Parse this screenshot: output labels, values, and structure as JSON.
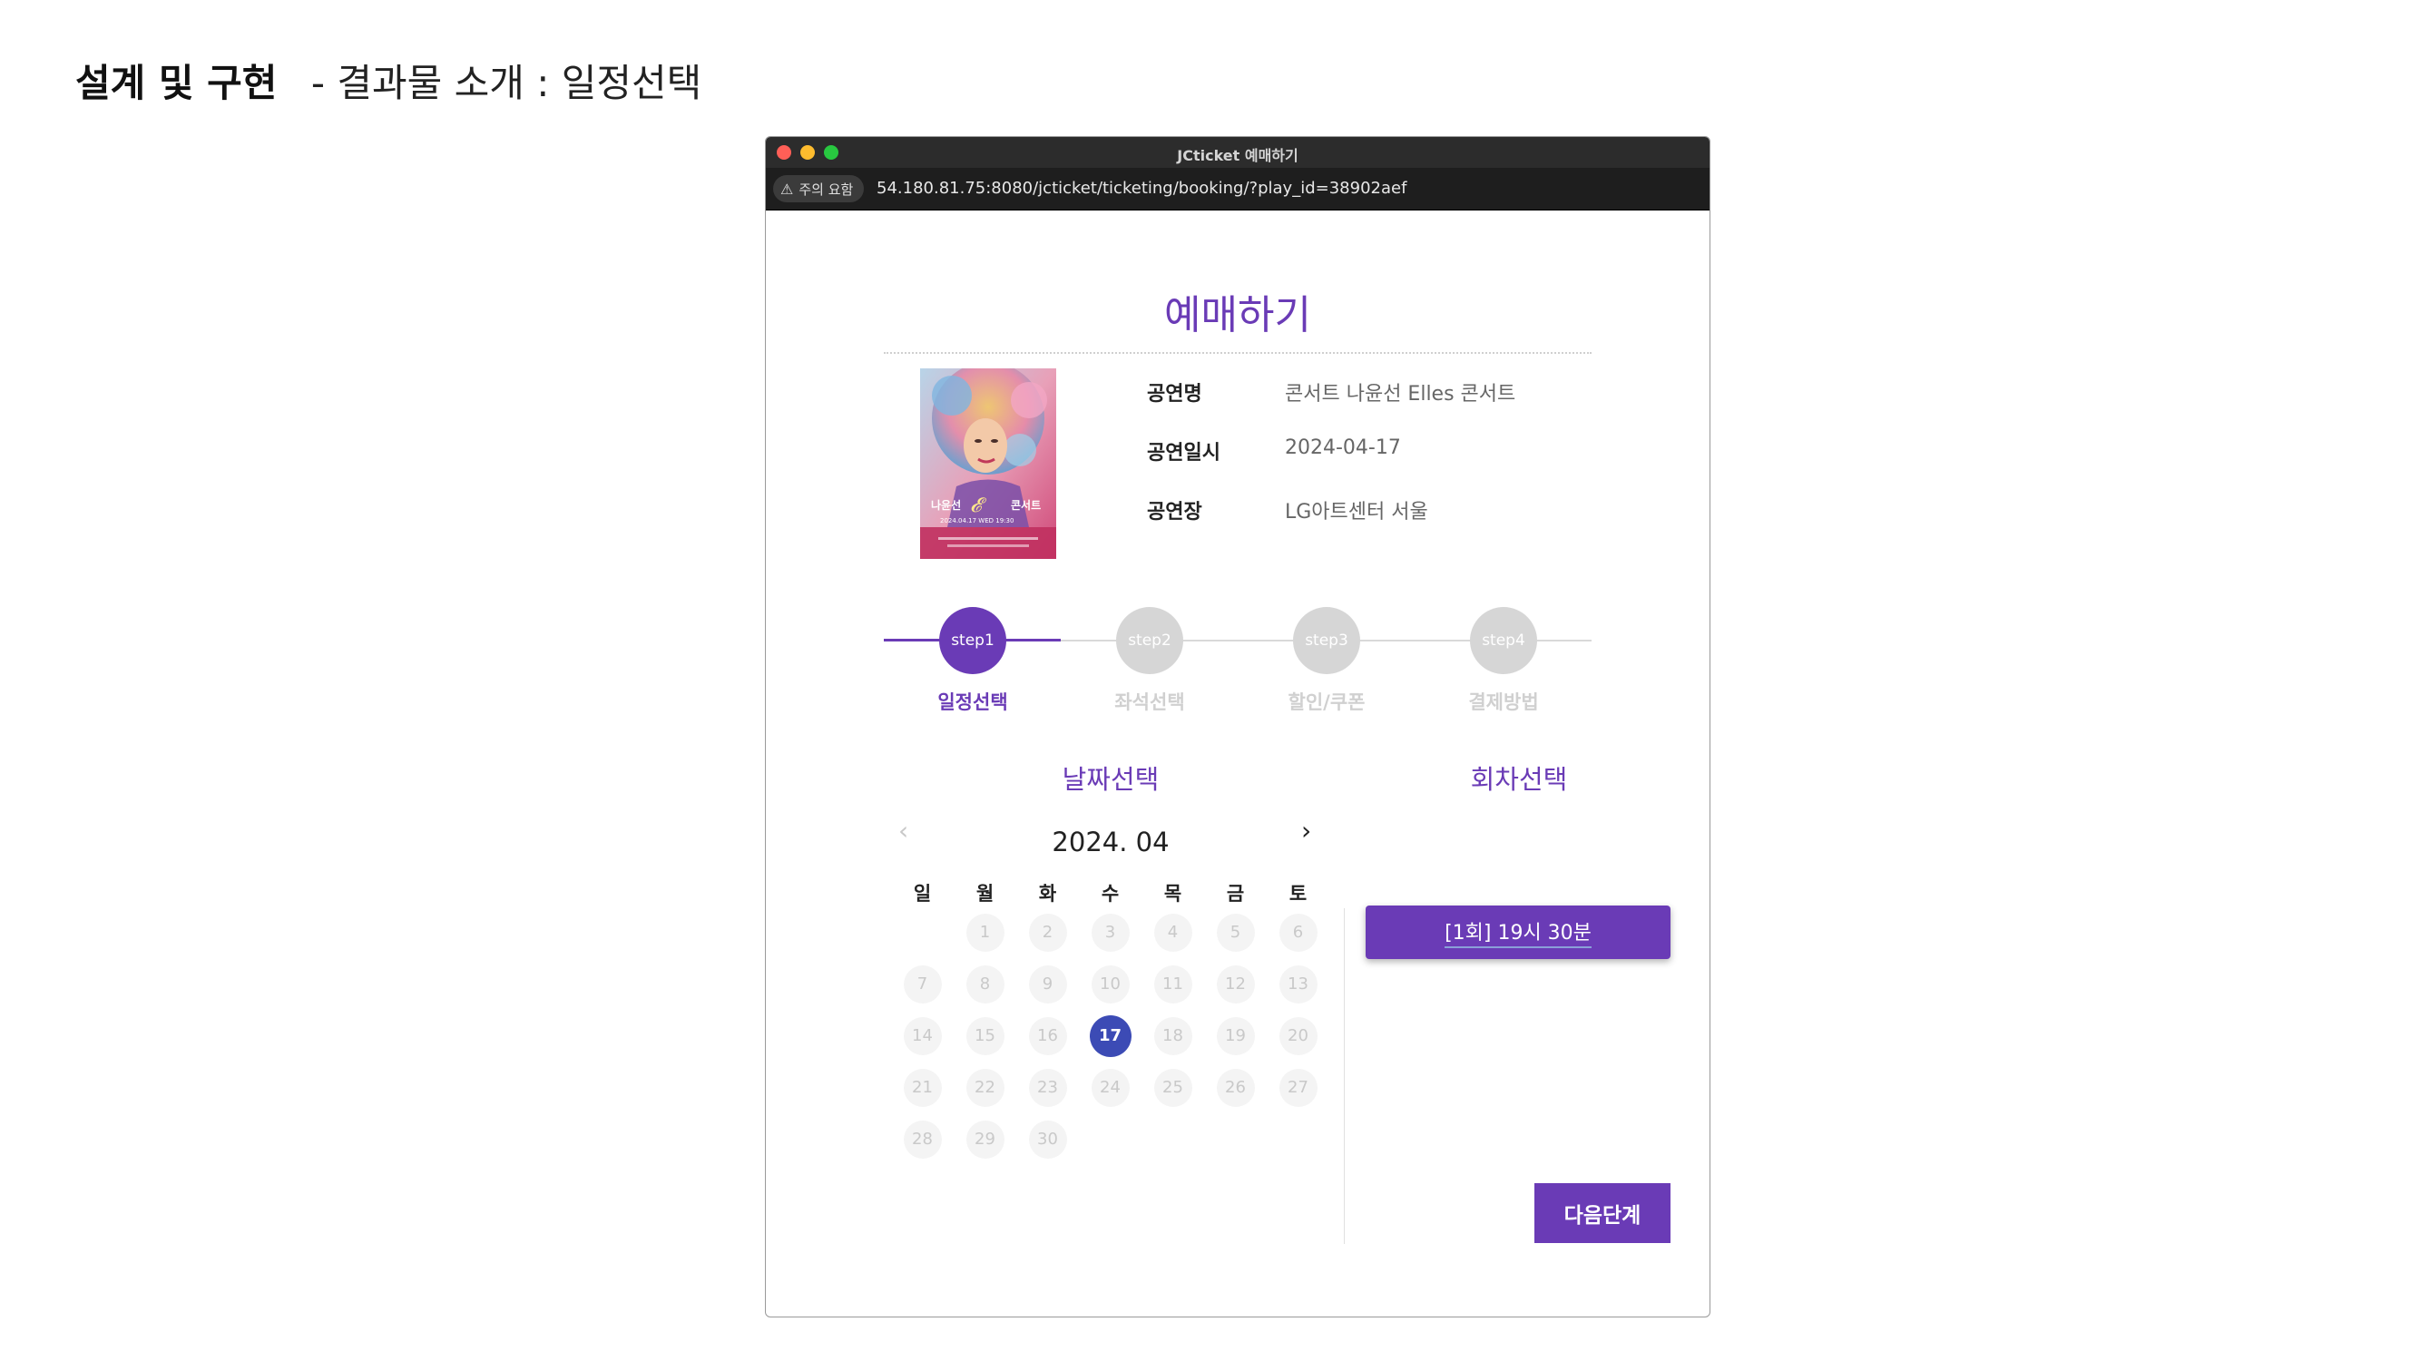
{
  "slide": {
    "title_bold": "설계 및 구현",
    "title_sub": "- 결과물 소개 :  일정선택"
  },
  "window": {
    "title": "JCticket 예매하기",
    "warning_label": "주의 요함",
    "url": "54.180.81.75:8080/jcticket/ticketing/booking/?play_id=38902aef"
  },
  "page": {
    "heading": "예매하기"
  },
  "poster": {
    "text_left": "나윤선",
    "text_right": "콘서트",
    "date_line": "2024.04.17 WED 19:30"
  },
  "info": [
    {
      "label": "공연명",
      "value": "콘서트 나윤선 Elles 콘서트"
    },
    {
      "label": "공연일시",
      "value": "2024-04-17"
    },
    {
      "label": "공연장",
      "value": "LG아트센터 서울"
    }
  ],
  "steps": [
    {
      "circle": "step1",
      "label": "일정선택",
      "active": true
    },
    {
      "circle": "step2",
      "label": "좌석선택",
      "active": false
    },
    {
      "circle": "step3",
      "label": "할인/쿠폰",
      "active": false
    },
    {
      "circle": "step4",
      "label": "결제방법",
      "active": false
    }
  ],
  "date_section": {
    "title": "날짜선택",
    "month": "2024. 04",
    "prev": "‹",
    "next": "›",
    "weekdays": [
      "일",
      "월",
      "화",
      "수",
      "목",
      "금",
      "토"
    ],
    "weeks": [
      [
        "",
        "1",
        "2",
        "3",
        "4",
        "5",
        "6"
      ],
      [
        "7",
        "8",
        "9",
        "10",
        "11",
        "12",
        "13"
      ],
      [
        "14",
        "15",
        "16",
        "17",
        "18",
        "19",
        "20"
      ],
      [
        "21",
        "22",
        "23",
        "24",
        "25",
        "26",
        "27"
      ],
      [
        "28",
        "29",
        "30",
        "",
        "",
        "",
        ""
      ]
    ],
    "selected_day": "17"
  },
  "session_section": {
    "title": "회차선택",
    "sessions": [
      "[1회] 19시 30분"
    ]
  },
  "next_button": "다음단계",
  "colors": {
    "accent": "#6a3bb6",
    "selected_day": "#3c4bb5",
    "inactive_step": "#d6d6d6"
  }
}
